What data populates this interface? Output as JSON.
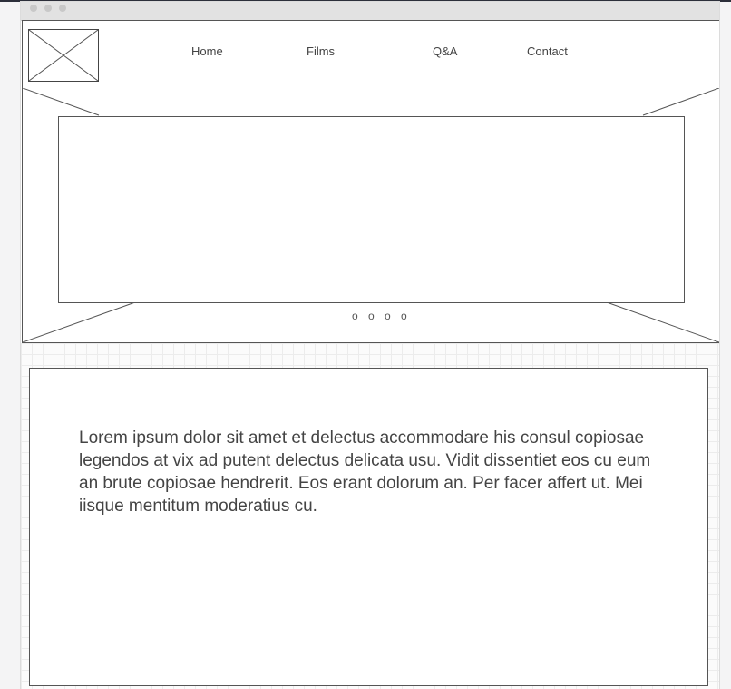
{
  "nav": {
    "items": [
      {
        "label": "Home"
      },
      {
        "label": "Films"
      },
      {
        "label": "Q&A"
      },
      {
        "label": "Contact"
      }
    ]
  },
  "carousel": {
    "indicators": "o o o o"
  },
  "content": {
    "body": "Lorem ipsum dolor sit amet et delectus accommodare his consul copiosae legendos at vix ad putent delectus delicata usu. Vidit dissentiet eos cu eum an brute copiosae hendrerit. Eos erant dolorum an. Per facer affert ut. Mei iisque mentitum moderatius cu."
  },
  "colors": {
    "line": "#555555",
    "text": "#444444",
    "grid": "#ececec",
    "titlebar": "#e2e2e2"
  },
  "icons": {
    "logo": "image-placeholder-icon",
    "window_controls": "window-dot-icon"
  }
}
